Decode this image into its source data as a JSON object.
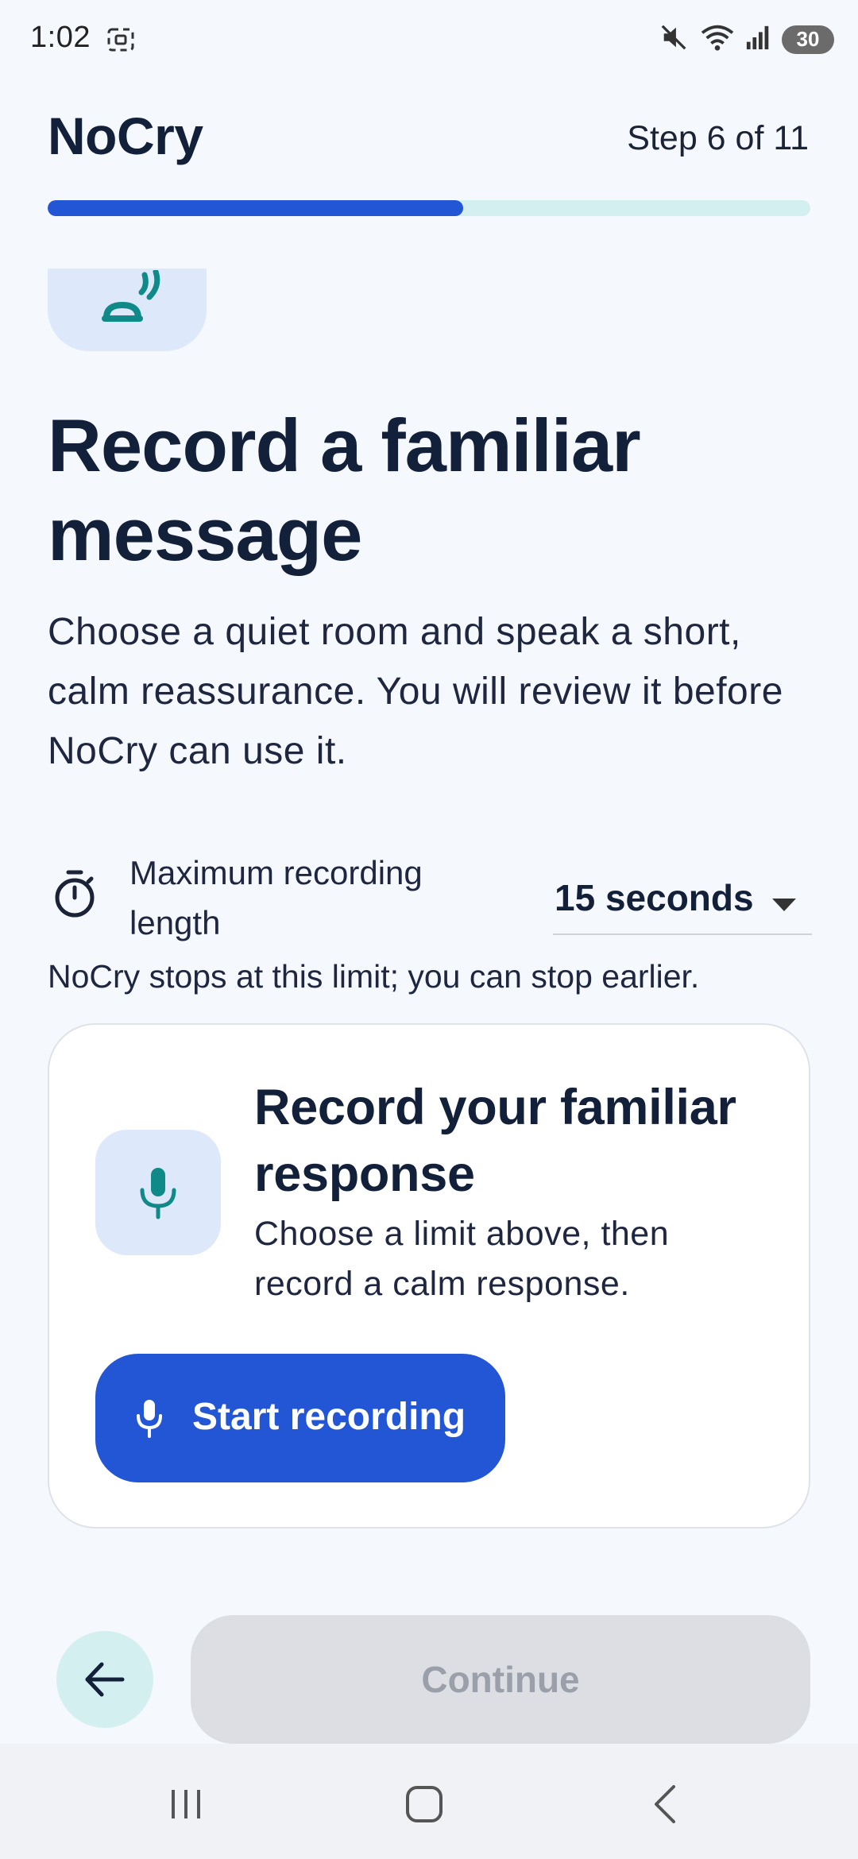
{
  "status_bar": {
    "time": "1:02",
    "battery": "30",
    "icons": [
      "screenshot-icon",
      "mute-icon",
      "wifi-icon",
      "signal-icon",
      "battery-icon"
    ]
  },
  "header": {
    "app_title": "NoCry",
    "step_text": "Step 6 of 11",
    "progress": 0.545
  },
  "main": {
    "hero_icon": "person-speaking-icon",
    "title": "Record a familiar message",
    "description": "Choose a quiet room and speak a short, calm reassurance. You will review it before NoCry can use it."
  },
  "limit": {
    "icon": "timer-icon",
    "label": "Maximum recording length",
    "selected_value": "15 seconds",
    "help_text": "NoCry stops at this limit; you can stop earlier."
  },
  "record_card": {
    "icon": "mic-icon",
    "title": "Record your familiar response",
    "description": "Choose a limit above, then record a calm response.",
    "button_label": "Start recording"
  },
  "footer": {
    "back_icon": "arrow-left-icon",
    "continue_label": "Continue"
  },
  "nav_bar": {
    "icons": [
      "recents-icon",
      "home-icon",
      "back-icon"
    ]
  },
  "colors": {
    "accent": "#2356d4",
    "progress_track": "#d4eff0",
    "teal_icon": "#0f8a88",
    "background": "#f5f8fd",
    "tile": "#dde8fb",
    "disabled": "#dcdee4"
  }
}
